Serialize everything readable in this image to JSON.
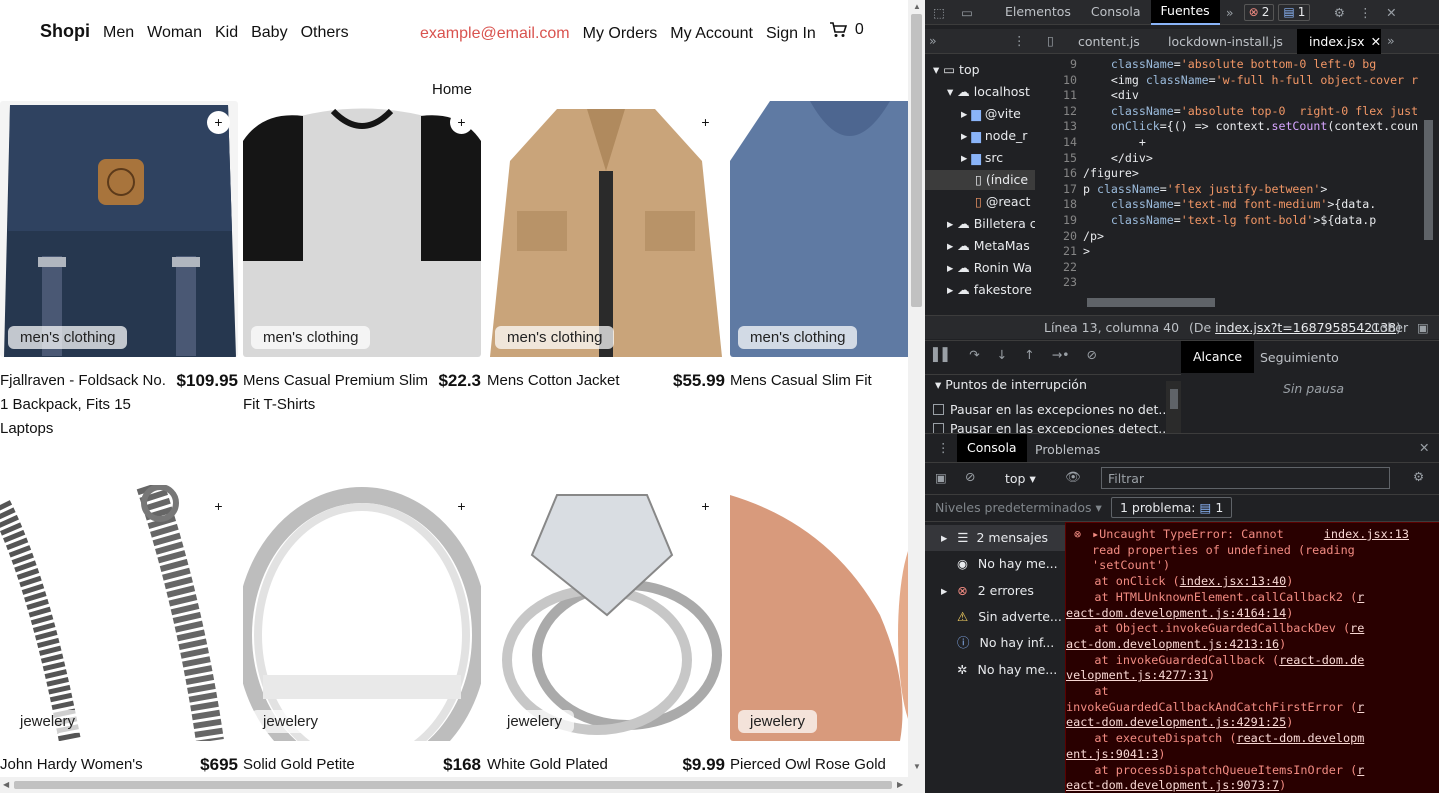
{
  "nav": {
    "brand": "Shopi",
    "links": [
      "Men",
      "Woman",
      "Kid",
      "Baby",
      "Others"
    ],
    "email": "example@email.com",
    "my_orders": "My Orders",
    "my_account": "My Account",
    "sign_in": "Sign In",
    "cart_count": "0"
  },
  "home_label": "Home",
  "products": [
    {
      "title": "Fjallraven - Foldsack No. 1 Backpack, Fits 15 Laptops",
      "price": "$109.95",
      "category": "men's clothing",
      "plus": "+"
    },
    {
      "title": "Mens Casual Premium Slim Fit T-Shirts",
      "price": "$22.3",
      "category": "men's clothing",
      "plus": "+"
    },
    {
      "title": "Mens Cotton Jacket",
      "price": "$55.99",
      "category": "men's clothing",
      "plus": "+"
    },
    {
      "title": "Mens Casual Slim Fit",
      "price": "",
      "category": "men's clothing",
      "plus": ""
    },
    {
      "title": "John Hardy Women's",
      "price": "$695",
      "category": "jewelery",
      "plus": "+"
    },
    {
      "title": "Solid Gold Petite",
      "price": "$168",
      "category": "jewelery",
      "plus": "+"
    },
    {
      "title": "White Gold Plated",
      "price": "$9.99",
      "category": "jewelery",
      "plus": "+"
    },
    {
      "title": "Pierced Owl Rose Gold",
      "price": "",
      "category": "jewelery",
      "plus": ""
    }
  ],
  "devtools": {
    "tabs": [
      "Elementos",
      "Consola",
      "Fuentes"
    ],
    "active_tab": "Fuentes",
    "error_count": "2",
    "message_count": "1",
    "file_tabs": [
      "content.js",
      "lockdown-install.js",
      "index.jsx"
    ],
    "tree": [
      "top",
      "localhost",
      "@vite",
      "node_r",
      "src",
      "(índice",
      "@react",
      "Billetera c",
      "MetaMas",
      "Ronin Wa",
      "fakestore"
    ],
    "code_lines": [
      {
        "n": "9",
        "html": "    <span <span class='k'>className</span>=<span class='s'>'absolute bottom-0 left-0 bg</span>"
      },
      {
        "n": "10",
        "html": "    <img <span class='k'>className</span>=<span class='s'>'w-full h-full object-cover r</span>"
      },
      {
        "n": "11",
        "html": "    <div"
      },
      {
        "n": "12",
        "html": "    <span class='k'>className</span>=<span class='s'>'absolute top-0  right-0 flex just</span>"
      },
      {
        "n": "13",
        "html": "    <span class='k'>onClick</span>={() => context.<span class='f'>setCount</span>(context.coun"
      },
      {
        "n": "14",
        "html": "        +"
      },
      {
        "n": "15",
        "html": "    </div>"
      },
      {
        "n": "16",
        "html": "/figure>"
      },
      {
        "n": "17",
        "html": "p <span class='k'>className</span>=<span class='s'>'flex justify-between'</span>>"
      },
      {
        "n": "18",
        "html": "    <span <span class='k'>className</span>=<span class='s'>'text-md font-medium'</span>>{data."
      },
      {
        "n": "19",
        "html": "    <span <span class='k'>className</span>=<span class='s'>'text-lg font-bold'</span>>${data.p"
      },
      {
        "n": "20",
        "html": "/p>"
      },
      {
        "n": "21",
        "html": ">"
      },
      {
        "n": "22",
        "html": ""
      },
      {
        "n": "23",
        "html": ""
      }
    ],
    "status_line": "Línea 13, columna 40",
    "status_file": "(De ",
    "status_link": "index.jsx?t=1687958542138",
    "status_close": ")",
    "status_cov": "Cober",
    "scope_tab": "Alcance",
    "watch_tab": "Seguimiento",
    "breakpoints_header": "Puntos de interrupción",
    "pause_ex1": "Pausar en las excepciones no det...",
    "pause_ex2": "Pausar en las excepciones detect...",
    "no_pause": "Sin pausa",
    "console_tab": "Consola",
    "problems_tab": "Problemas",
    "context": "top",
    "filter_placeholder": "Filtrar",
    "levels": "Niveles predeterminados",
    "problems_badge": "1 problema:",
    "problems_badge_count": "1",
    "side_items": [
      "2 mensajes",
      "No hay me...",
      "2 errores",
      "Sin advertе...",
      "No hay inf...",
      "No hay me..."
    ],
    "error_source": "index.jsx:13",
    "error_msg_lines": [
      "Uncaught TypeError: Cannot",
      "read properties of undefined (reading",
      "'setCount')"
    ],
    "stack": [
      {
        "pre": "    at onClick (",
        "link": "index.jsx:13:40",
        "post": ")"
      },
      {
        "pre": "    at HTMLUnknownElement.callCallback2 (",
        "link": "r",
        "post": ""
      },
      {
        "pre": "",
        "link": "eact-dom.development.js:4164:14",
        "post": ")"
      },
      {
        "pre": "    at Object.invokeGuardedCallbackDev (",
        "link": "re",
        "post": ""
      },
      {
        "pre": "",
        "link": "act-dom.development.js:4213:16",
        "post": ")"
      },
      {
        "pre": "    at invokeGuardedCallback (",
        "link": "react-dom.de",
        "post": ""
      },
      {
        "pre": "",
        "link": "velopment.js:4277:31",
        "post": ")"
      },
      {
        "pre": "    at",
        "link": "",
        "post": ""
      },
      {
        "pre": "invokeGuardedCallbackAndCatchFirstError (",
        "link": "r",
        "post": ""
      },
      {
        "pre": "",
        "link": "eact-dom.development.js:4291:25",
        "post": ")"
      },
      {
        "pre": "    at executeDispatch (",
        "link": "react-dom.developm",
        "post": ""
      },
      {
        "pre": "",
        "link": "ent.js:9041:3",
        "post": ")"
      },
      {
        "pre": "    at processDispatchQueueItemsInOrder (",
        "link": "r",
        "post": ""
      },
      {
        "pre": "",
        "link": "eact-dom.development.js:9073:7",
        "post": ")"
      }
    ]
  }
}
